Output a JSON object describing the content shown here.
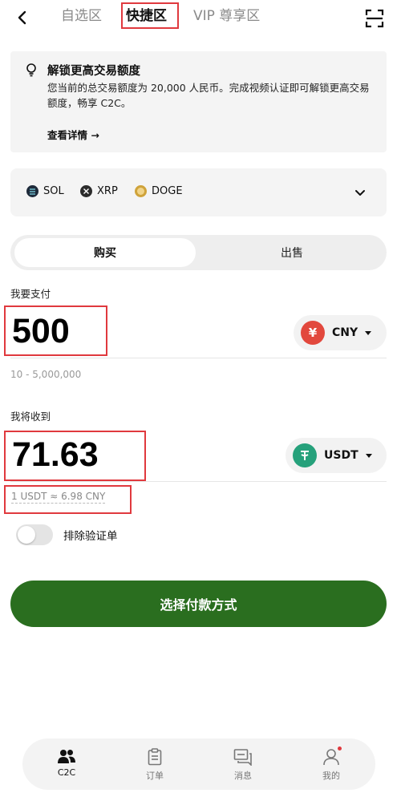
{
  "header": {
    "tabs": [
      {
        "label": "自选区",
        "active": false
      },
      {
        "label": "快捷区",
        "active": true
      },
      {
        "label": "VIP 尊享区",
        "active": false
      }
    ]
  },
  "notice": {
    "title": "解锁更高交易额度",
    "description": "您当前的总交易额度为 20,000 人民币。完成视频认证即可解锁更高交易额度，畅享 C2C。",
    "link": "查看详情 →"
  },
  "coins": [
    {
      "symbol": "SOL",
      "icon": "sol-icon"
    },
    {
      "symbol": "XRP",
      "icon": "xrp-icon"
    },
    {
      "symbol": "DOGE",
      "icon": "doge-icon"
    }
  ],
  "trade_toggle": {
    "buy": "购买",
    "sell": "出售",
    "selected": "buy"
  },
  "pay": {
    "label": "我要支付",
    "amount": "500",
    "currency": "CNY",
    "currency_symbol": "¥",
    "limits": "10 - 5,000,000"
  },
  "receive": {
    "label": "我将收到",
    "amount": "71.63",
    "currency": "USDT",
    "rate": "1 USDT ≈ 6.98 CNY"
  },
  "exclude_verification": {
    "label": "排除验证单",
    "enabled": false
  },
  "cta": {
    "label": "选择付款方式"
  },
  "bottom_nav": [
    {
      "label": "C2C",
      "icon": "people-icon",
      "active": true
    },
    {
      "label": "订单",
      "icon": "clipboard-icon",
      "active": false
    },
    {
      "label": "消息",
      "icon": "chat-icon",
      "active": false
    },
    {
      "label": "我的",
      "icon": "profile-icon",
      "active": false,
      "badge": true
    }
  ],
  "colors": {
    "accent_green": "#2a6e1f",
    "highlight_red": "#e0393e",
    "cny_red": "#e2483d",
    "usdt_teal": "#26a17b"
  }
}
